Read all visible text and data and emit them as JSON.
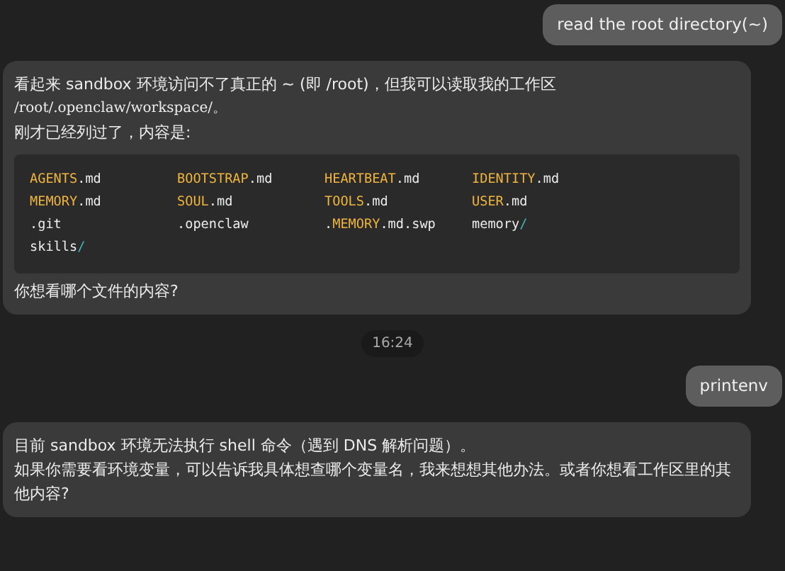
{
  "messages": [
    {
      "kind": "user",
      "text": "read the root directory(~)"
    },
    {
      "kind": "bot",
      "blocks": [
        {
          "kind": "line",
          "segments": [
            {
              "kind": "plain",
              "text": "看起来 sandbox 环境访问不了真正的 ~ (即 /root)，但我可以读取我的工作区"
            }
          ]
        },
        {
          "kind": "line",
          "segments": [
            {
              "kind": "code",
              "text": "/root/.openclaw/workspace/。"
            }
          ]
        },
        {
          "kind": "line",
          "segments": [
            {
              "kind": "plain",
              "text": "刚才已经列过了，内容是:"
            }
          ]
        },
        {
          "kind": "listing",
          "entries": [
            [
              {
                "kind": "name",
                "text": "AGENTS"
              },
              {
                "kind": "plain",
                "text": ".md"
              }
            ],
            [
              {
                "kind": "name",
                "text": "BOOTSTRAP"
              },
              {
                "kind": "plain",
                "text": ".md"
              }
            ],
            [
              {
                "kind": "name",
                "text": "HEARTBEAT"
              },
              {
                "kind": "plain",
                "text": ".md"
              }
            ],
            [
              {
                "kind": "name",
                "text": "IDENTITY"
              },
              {
                "kind": "plain",
                "text": ".md"
              }
            ],
            [
              {
                "kind": "name",
                "text": "MEMORY"
              },
              {
                "kind": "plain",
                "text": ".md"
              }
            ],
            [
              {
                "kind": "name",
                "text": "SOUL"
              },
              {
                "kind": "plain",
                "text": ".md"
              }
            ],
            [
              {
                "kind": "name",
                "text": "TOOLS"
              },
              {
                "kind": "plain",
                "text": ".md"
              }
            ],
            [
              {
                "kind": "name",
                "text": "USER"
              },
              {
                "kind": "plain",
                "text": ".md"
              }
            ],
            [
              {
                "kind": "plain",
                "text": ".git"
              }
            ],
            [
              {
                "kind": "plain",
                "text": ".openclaw"
              }
            ],
            [
              {
                "kind": "plain",
                "text": "."
              },
              {
                "kind": "name",
                "text": "MEMORY"
              },
              {
                "kind": "plain",
                "text": ".md.swp"
              }
            ],
            [
              {
                "kind": "plain",
                "text": "memory"
              },
              {
                "kind": "slash",
                "text": "/"
              }
            ],
            [
              {
                "kind": "plain",
                "text": "skills"
              },
              {
                "kind": "slash",
                "text": "/"
              }
            ]
          ]
        },
        {
          "kind": "line",
          "segments": [
            {
              "kind": "plain",
              "text": "你想看哪个文件的内容?"
            }
          ]
        }
      ]
    },
    {
      "kind": "time",
      "text": "16:24"
    },
    {
      "kind": "user",
      "text": "printenv"
    },
    {
      "kind": "bot",
      "blocks": [
        {
          "kind": "line",
          "segments": [
            {
              "kind": "plain",
              "text": "目前 sandbox 环境无法执行 shell 命令（遇到 DNS 解析问题）。"
            }
          ]
        },
        {
          "kind": "line",
          "segments": [
            {
              "kind": "plain",
              "text": "如果你需要看环境变量，可以告诉我具体想查哪个变量名，我来想想其他办法。或者你想看工作区里的其他内容?"
            }
          ]
        }
      ]
    }
  ]
}
